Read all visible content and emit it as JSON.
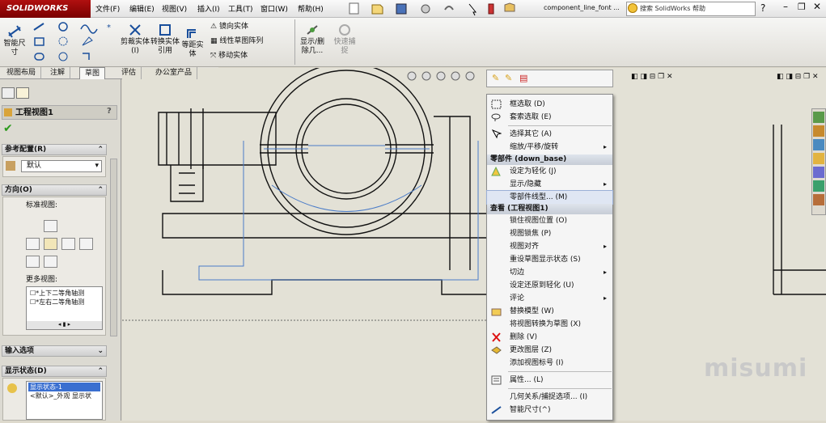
{
  "app": {
    "brand": "SOLIDWORKS",
    "doc_title": "component_line_font ...",
    "search_placeholder": "搜索 SolidWorks 帮助"
  },
  "menus": [
    "文件(F)",
    "编辑(E)",
    "视图(V)",
    "插入(I)",
    "工具(T)",
    "窗口(W)",
    "帮助(H)"
  ],
  "ribbon": {
    "smart_dim": "智能尺寸",
    "trim": "剪裁实体(I)",
    "convert": "转换实体引用",
    "offset": "等距实体",
    "mirror": "镜向实体",
    "linear_pattern": "线性草图阵列",
    "move": "移动实体",
    "show_hide": "显示/删除几...",
    "quick_snap": "快速捕捉"
  },
  "tabs": [
    "视图布局",
    "注解",
    "草图",
    "评估",
    "办公室产品"
  ],
  "active_tab": 2,
  "panel": {
    "title": "工程视图1",
    "ref_config": "参考配置(R)",
    "config_value": "默认",
    "orientation": "方向(O)",
    "std_views": "标准视图:",
    "more_views": "更多视图:",
    "more_list": [
      "*上下二等角轴测",
      "*左右二等角轴测"
    ],
    "import_opts": "输入选项",
    "display_state": "显示状态(D)",
    "ds_list": [
      "显示状态-1",
      "<默认>_外观 显示状"
    ]
  },
  "context_menu": {
    "items1": [
      {
        "label": "框选取 (D)",
        "icon": "box-select-icon"
      },
      {
        "label": "套索选取 (E)",
        "icon": "lasso-icon"
      }
    ],
    "items2": [
      {
        "label": "选择其它 (A)",
        "icon": "select-other-icon"
      },
      {
        "label": "缩放/平移/旋转",
        "submenu": true
      }
    ],
    "part_header": "零部件 (down_base)",
    "items3": [
      {
        "label": "设定为轻化 (J)",
        "icon": "lightweight-icon"
      },
      {
        "label": "显示/隐藏",
        "submenu": true
      },
      {
        "label": "零部件线型... (M)",
        "highlight": true
      }
    ],
    "view_header": "查看 (工程视图1)",
    "items4": [
      {
        "label": "锁住视图位置 (O)"
      },
      {
        "label": "视图锁焦 (P)"
      },
      {
        "label": "视图对齐",
        "submenu": true
      },
      {
        "label": "重设草图显示状态 (S)"
      },
      {
        "label": "切边",
        "submenu": true
      },
      {
        "label": "设定还原到轻化 (U)"
      },
      {
        "label": "评论",
        "submenu": true
      },
      {
        "label": "替换模型 (W)",
        "icon": "replace-model-icon"
      },
      {
        "label": "将视图转换为草图 (X)"
      },
      {
        "label": "删除 (V)",
        "icon": "delete-icon"
      },
      {
        "label": "更改图层 (Z)",
        "icon": "layer-icon"
      },
      {
        "label": "添加视图标号 (I)"
      },
      {
        "label": "属性... (L)",
        "icon": "properties-icon"
      }
    ],
    "items5": [
      {
        "label": "几何关系/捕捉选项... (I)"
      },
      {
        "label": "智能尺寸(^)",
        "icon": "smart-dimension-icon"
      }
    ]
  },
  "watermark": "misumi"
}
